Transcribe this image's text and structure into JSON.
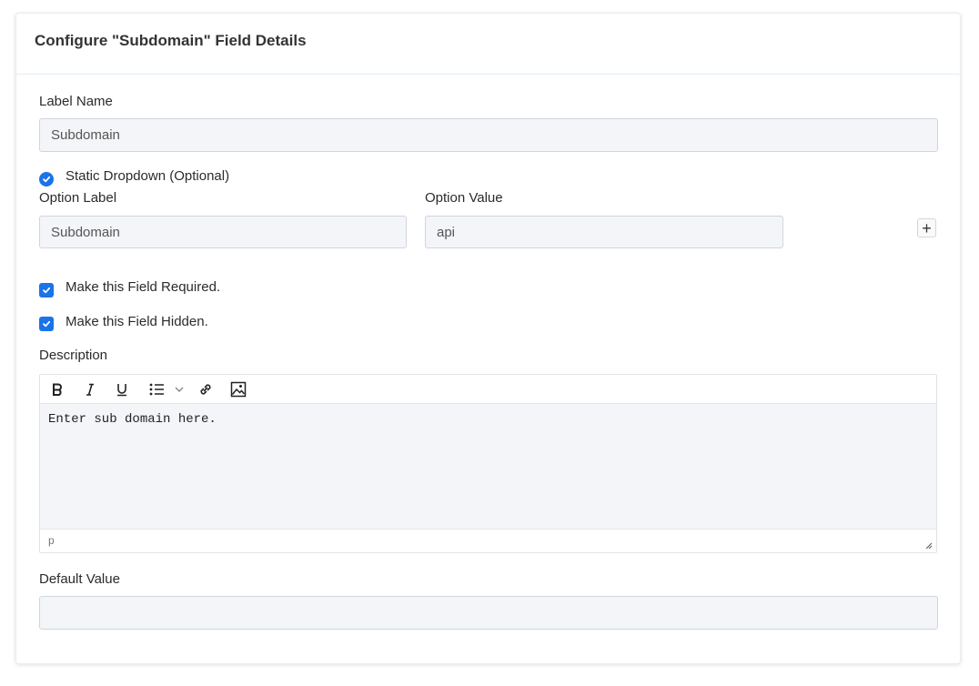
{
  "header": {
    "title": "Configure \"Subdomain\" Field Details"
  },
  "label_name": {
    "label": "Label Name",
    "value": "Subdomain"
  },
  "static_dropdown": {
    "label": "Static Dropdown (Optional)",
    "checked": true
  },
  "option_label": {
    "label": "Option Label",
    "value": "Subdomain"
  },
  "option_value": {
    "label": "Option Value",
    "value": "api"
  },
  "add_button": {
    "label": "+"
  },
  "required": {
    "label": "Make this Field Required.",
    "checked": true
  },
  "hidden": {
    "label": "Make this Field Hidden.",
    "checked": true
  },
  "description": {
    "label": "Description",
    "content": "Enter sub domain here.",
    "path": "p",
    "toolbar": [
      "bold-icon",
      "italic-icon",
      "underline-icon",
      "bullet-list-icon",
      "chevron-down-icon",
      "link-icon",
      "image-icon"
    ]
  },
  "default_value": {
    "label": "Default Value",
    "value": ""
  },
  "colors": {
    "accent": "#1a73e8",
    "input_bg": "#f3f5f8",
    "input_border": "#cfd6df"
  }
}
